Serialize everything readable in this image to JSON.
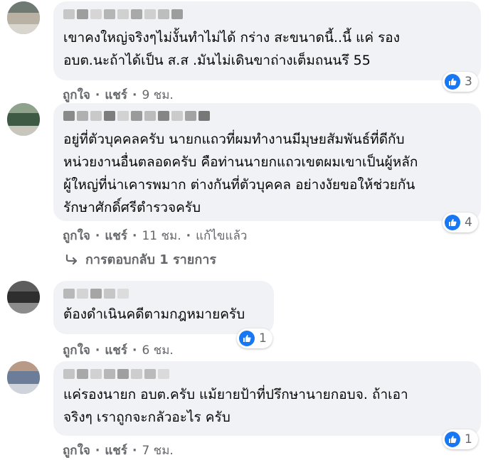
{
  "comments": [
    {
      "text": "เขาคงใหญ่จริงๆไม่งั้นทำไม่ได้ กร่าง สะขนาดนี้..นี้ แค่ รอง\nอบต.นะถ้าได้เป็น ส.ส .มันไม่เดินขาถ่างเต็มถนนรึ 55",
      "reactions": "3",
      "like_label": "ถูกใจ",
      "share_label": "แชร์",
      "time": "9 ชม."
    },
    {
      "text": "อยู่ที่ตัวบุคคลครับ นายกแถวที่ผมทำงานมีมุษยสัมพันธ์ที่ดีกับ\nหน่วยงานอื่นตลอดครับ คือท่านนายกแถวเขตผมเขาเป็นผู้หลัก\nผู้ใหญ่ที่น่าเคารพมาก ต่างกันที่ตัวบุคคล อย่างงัยขอให้ช่วยกัน\nรักษาศักดิ์ศรีตำรวจครับ",
      "reactions": "4",
      "like_label": "ถูกใจ",
      "share_label": "แชร์",
      "time": "11 ชม.",
      "edited": "แก้ไขแล้ว"
    },
    {
      "text": "ต้องดำเนินคดีตามกฎหมายครับ",
      "reactions": "1",
      "like_label": "ถูกใจ",
      "share_label": "แชร์",
      "time": "6 ชม."
    },
    {
      "text": "แค่รองนายก อบต.ครับ แม้ยายป้าที่ปรึกษานายกอบจ. ถ้าเอา\nจริงๆ เราถูกจะกลัวอะไร ครับ",
      "reactions": "1",
      "like_label": "ถูกใจ",
      "share_label": "แชร์",
      "time": "7 ชม."
    }
  ],
  "replies_link": "การตอบกลับ 1 รายการ",
  "colors": {
    "bubble": "#f0f2f5",
    "like_blue": "#1877f2",
    "meta_gray": "#65676b"
  },
  "icons": {
    "reaction": "like-icon",
    "reply": "reply-arrow-icon"
  }
}
